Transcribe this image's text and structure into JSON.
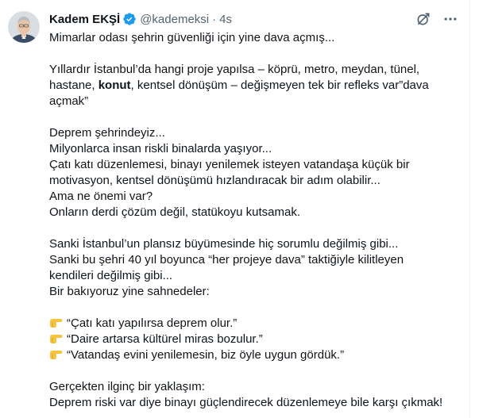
{
  "tweet": {
    "author_name": "Kadem EKŞİ",
    "handle": "@kademeksi",
    "separator": "·",
    "time": "4s",
    "lines": [
      [
        "Mimarlar odası şehrin güvenliği için yine dava açmış..."
      ],
      [],
      [
        "Yıllardır İstanbul’da hangi proje yapılsa – köprü, metro, meydan, tünel,"
      ],
      [
        "hastane, ",
        "konut",
        ", kentsel dönüşüm – değişmeyen tek bir refleks var”dava"
      ],
      [
        "açmak”"
      ],
      [],
      [
        "Deprem şehrindeyiz..."
      ],
      [
        "Milyonlarca insan riskli binalarda yaşıyor..."
      ],
      [
        "Çatı katı düzenlemesi, binayı yenilemek isteyen vatandaşa küçük bir"
      ],
      [
        "motivasyon, kentsel dönüşümü hızlandıracak bir adım olabilir..."
      ],
      [
        "Ama ne önemi var?"
      ],
      [
        "Onların derdi çözüm değil, statükoyu kutsamak."
      ],
      [],
      [
        "Sanki İstanbul’un plansız büyümesinde hiç sorumlu değilmiş gibi..."
      ],
      [
        "Sanki bu şehri 40 yıl boyunca “her projeye dava” taktiğiyle kilitleyen"
      ],
      [
        "kendileri değilmiş gibi..."
      ],
      [
        "Bir bakıyoruz yine sahnedeler:"
      ],
      [],
      [
        "“Çatı katı yapılırsa deprem olur.”"
      ],
      [
        "“Daire artarsa kültürel miras bozulur.”"
      ],
      [
        "“Vatandaş evini yenilemesin, biz öyle uygun gördük.”"
      ],
      [],
      [
        "Gerçekten ilginç bir yaklaşım:"
      ],
      [
        "Deprem riski var diye binayı güçlendirecek düzenlemeye bile karşı çıkmak!"
      ]
    ]
  },
  "icons": {
    "verified": "verified-badge-icon",
    "grok": "grok-icon",
    "more": "more-icon",
    "pointing": "backhand-index-pointing-right-icon"
  },
  "colors": {
    "verified": "#1d9bf0",
    "text": "#0f1419",
    "muted": "#536471",
    "emoji": "#f5c542"
  }
}
